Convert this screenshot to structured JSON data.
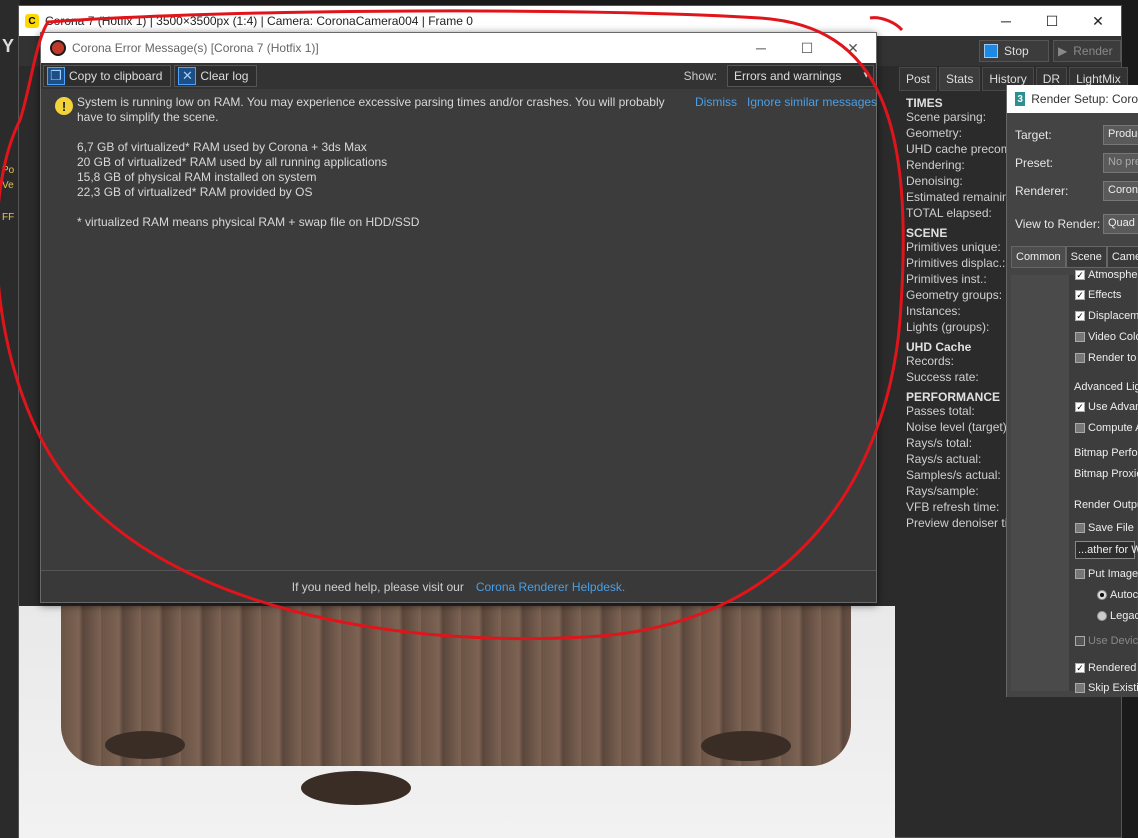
{
  "max_strip": {
    "items": [
      "Po",
      "Ve",
      "FF",
      "Y"
    ]
  },
  "vfb": {
    "title": "Corona 7 (Hotfix 1) | 3500×3500px (1:4) | Camera: CoronaCamera004 | Frame 0",
    "stop_label": "Stop",
    "render_label": "Render"
  },
  "right_tabs": [
    "Post",
    "Stats",
    "History",
    "DR",
    "LightMix"
  ],
  "stats": {
    "times_head": "TIMES",
    "times": [
      "Scene parsing:",
      "Geometry:",
      "UHD cache precom",
      "Rendering:",
      "Denoising:",
      "Estimated remainin",
      "TOTAL elapsed:"
    ],
    "scene_head": "SCENE",
    "scene": [
      "Primitives unique:",
      "Primitives displac.:",
      "Primitives inst.:",
      "Geometry groups:",
      "Instances:",
      "Lights (groups):"
    ],
    "uhd_head": "UHD Cache",
    "uhd": [
      "Records:",
      "Success rate:"
    ],
    "perf_head": "PERFORMANCE",
    "perf": [
      "Passes total:",
      "Noise level (target):",
      "Rays/s total:",
      "Rays/s actual:",
      "Samples/s actual:",
      "Rays/sample:",
      "VFB refresh time:",
      "Preview denoiser tin"
    ]
  },
  "render_setup": {
    "title": "Render Setup: Coro",
    "target_label": "Target:",
    "target_value": "Produc",
    "preset_label": "Preset:",
    "preset_value": "No pre",
    "renderer_label": "Renderer:",
    "renderer_value": "Corona",
    "view_label": "View to Render:",
    "view_value": "Quad 4",
    "tabs": [
      "Common",
      "Scene",
      "Camer"
    ],
    "items": {
      "atmos": "Atmosphe",
      "effects": "Effects",
      "displace": "Displaceme",
      "videocolor": "Video Colo",
      "rendertofields": "Render to",
      "advlight": "Advanced Lig",
      "useadv": "Use Advan",
      "computea": "Compute A",
      "bitmapperf": "Bitmap Perfor",
      "bitmapprox": "Bitmap Proxie",
      "renderout": "Render Outpu",
      "savefile": "Save File",
      "gatherfor": "...ather for W",
      "putimage": "Put Image",
      "autoc": "Autoc",
      "legac": "Legac",
      "usedevice": "Use Device",
      "rendered": "Rendered",
      "skipexist": "Skip Existin"
    }
  },
  "error_dialog": {
    "title": "Corona Error Message(s)     [Corona 7 (Hotfix 1)]",
    "copy_label": "Copy to clipboard",
    "clear_label": "Clear log",
    "show_label": "Show:",
    "show_value": "Errors and warnings",
    "message_lines": [
      "System is running low on RAM. You may experience excessive parsing times and/or crashes. You will probably have to simplify the scene.",
      "6,7 GB of virtualized* RAM used by Corona + 3ds Max",
      "20 GB of virtualized* RAM used by all running applications",
      "15,8 GB of physical RAM installed on system",
      "22,3 GB of virtualized* RAM provided by OS",
      "* virtualized RAM means physical RAM + swap file on HDD/SSD"
    ],
    "dismiss_label": "Dismiss",
    "ignore_label": "Ignore similar messages",
    "footer_text": "If you need help, please visit our",
    "footer_link": "Corona Renderer Helpdesk."
  },
  "colors": {
    "accent_link": "#4a9fe6",
    "annotation": "#e0141b",
    "warning": "#f2d33a"
  }
}
